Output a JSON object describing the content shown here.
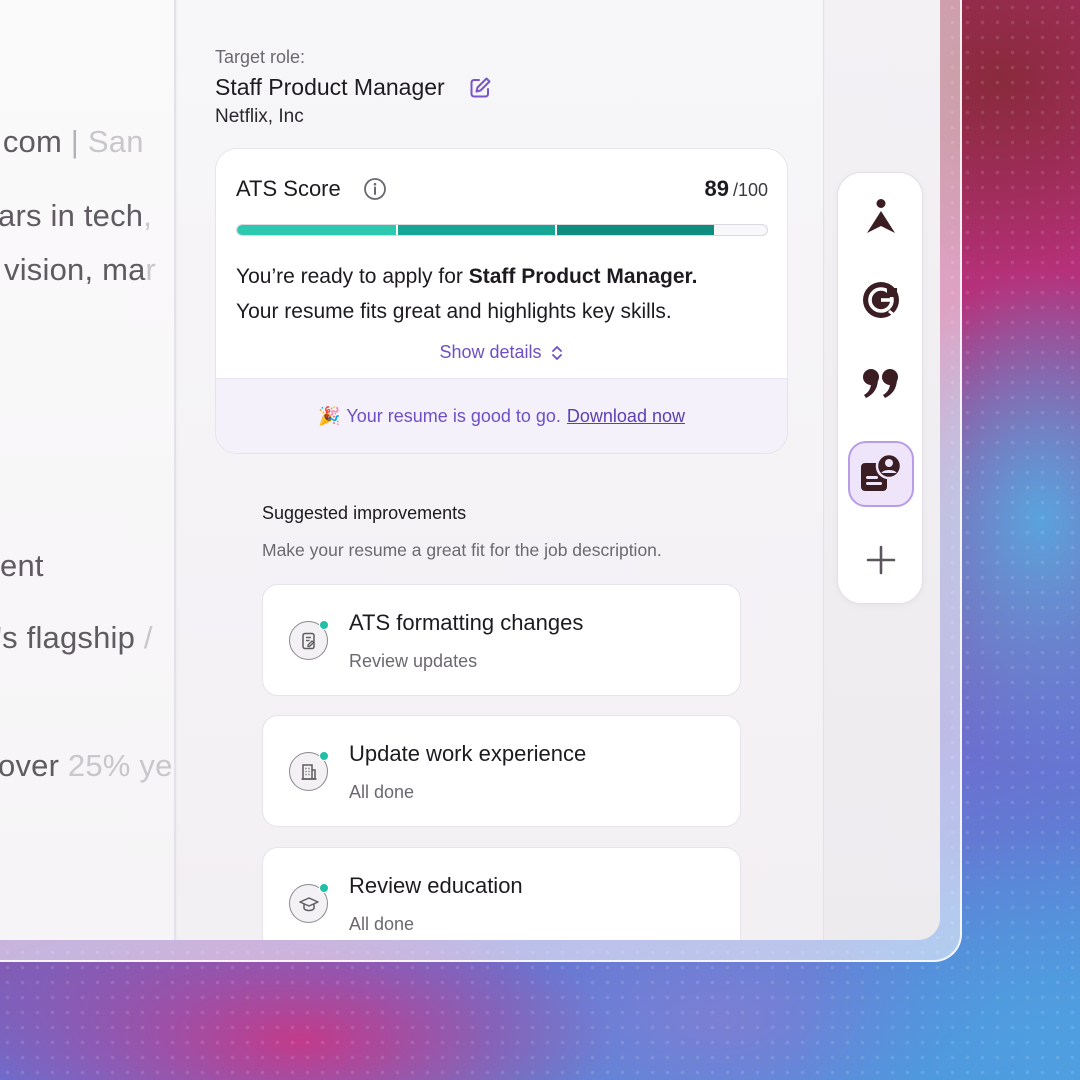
{
  "resume": {
    "lines": [
      {
        "main": ".com",
        "sep": " | ",
        "fade": "San"
      },
      {
        "main": "ars in tech",
        "fade": ","
      },
      {
        "main": "vision, ma",
        "fade": "r"
      },
      {
        "main": "ent",
        "fade": ""
      },
      {
        "main": "'s flagship",
        "fade": " /"
      },
      {
        "main": "over ",
        "fade": "25% ye"
      }
    ]
  },
  "target": {
    "label": "Target role:",
    "role": "Staff Product Manager",
    "company": "Netflix, Inc"
  },
  "ats": {
    "title": "ATS Score",
    "score": "89",
    "denominator": "/100",
    "progress_fraction": 0.9,
    "colors": {
      "seg1": "#2dc8b0",
      "seg2": "#16a696",
      "seg3": "#0e8c7f"
    },
    "message_prefix": "You’re ready to apply for ",
    "message_role": "Staff Product Manager.",
    "message_line2": "Your resume fits great and highlights key skills.",
    "show_details": "Show details",
    "footer_emoji": "🎉",
    "footer_text": "Your resume is good to go.",
    "footer_link": "Download now"
  },
  "suggestions": {
    "title": "Suggested improvements",
    "subtitle": "Make your resume a great fit for the job description.",
    "items": [
      {
        "name": "ATS formatting changes",
        "status": "Review updates",
        "icon": "document-edit-icon"
      },
      {
        "name": "Update work experience",
        "status": "All done",
        "icon": "building-icon"
      },
      {
        "name": "Review education",
        "status": "All done",
        "icon": "graduation-cap-icon"
      }
    ]
  },
  "toolbar": {
    "items": [
      "navigator-icon",
      "grammarly-g-icon",
      "quote-icon",
      "resume-profile-icon",
      "plus-icon"
    ],
    "active": "resume-profile-icon"
  },
  "colors": {
    "accent": "#6e4fc4",
    "teal": "#22bfa8",
    "toolbar_icon": "#3b1d24"
  }
}
